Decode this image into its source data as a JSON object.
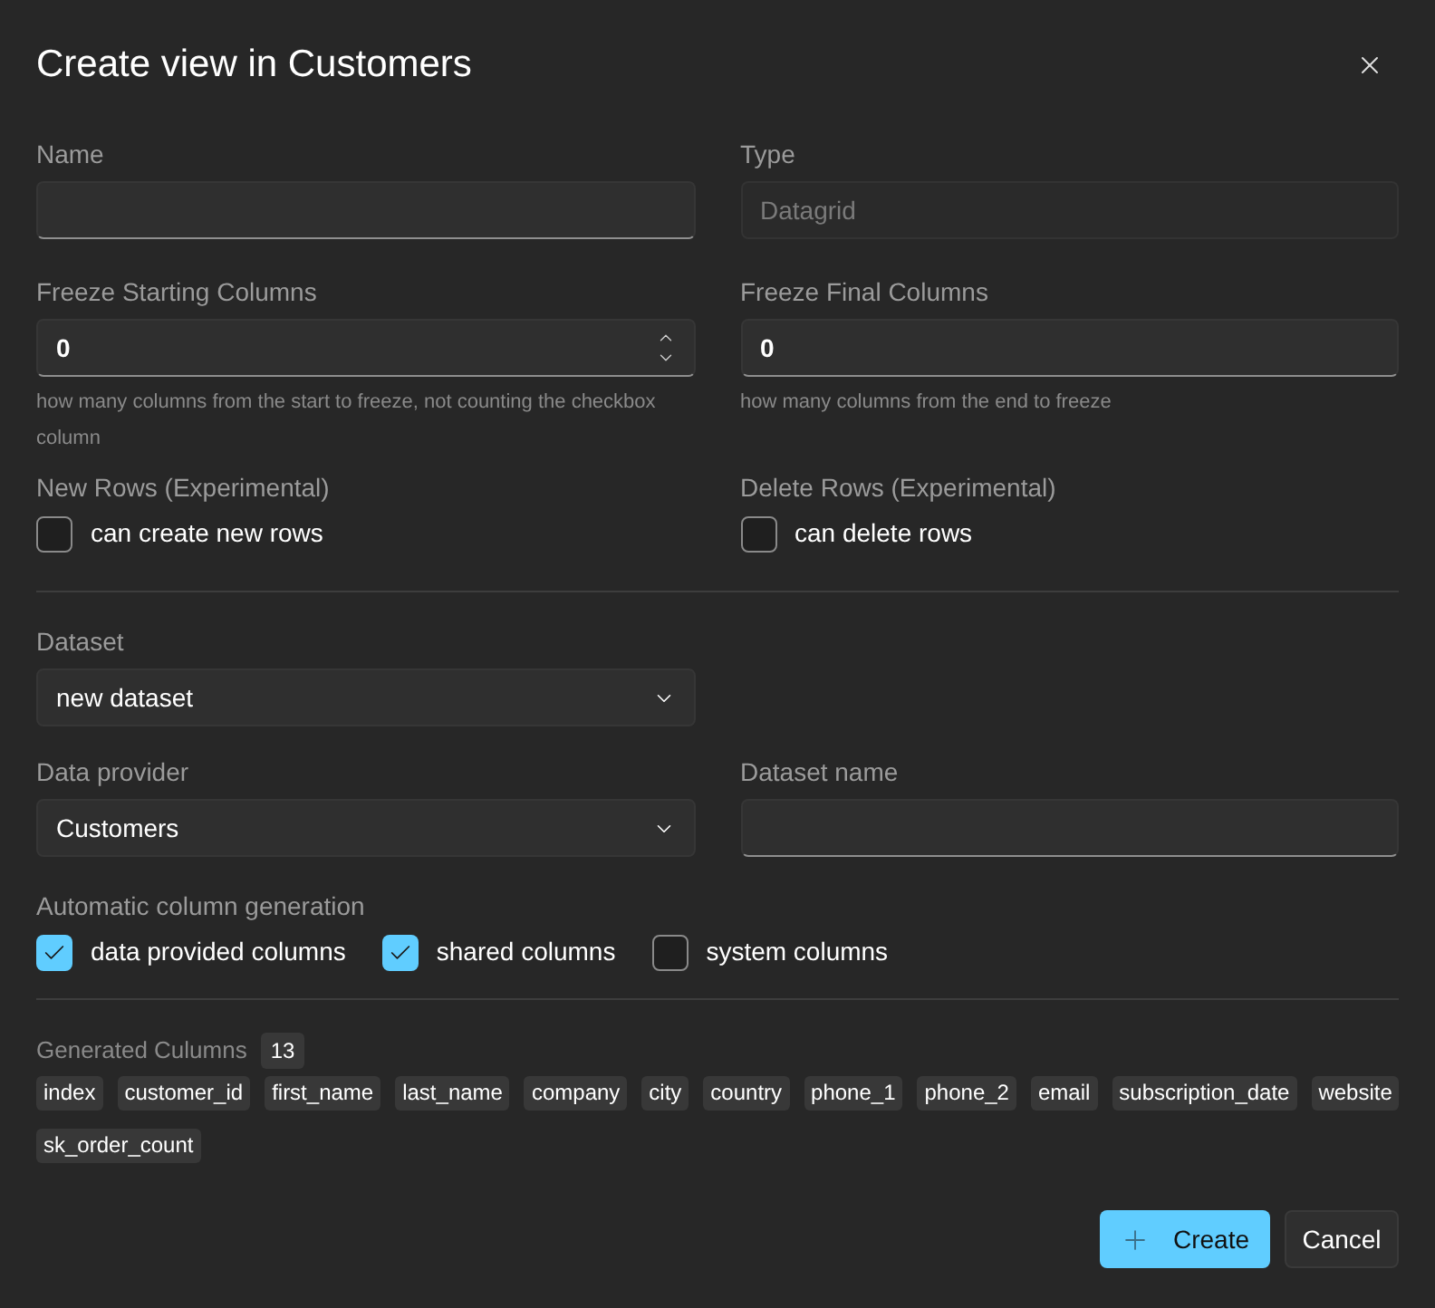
{
  "dialog": {
    "title": "Create view in Customers"
  },
  "name_field": {
    "label": "Name",
    "disabled": false
  },
  "type_field": {
    "label": "Type",
    "value": "Datagrid",
    "disabled": true
  },
  "freeze_start": {
    "label": "Freeze Starting Columns",
    "value": "0",
    "hint": "how many columns from the start to freeze, not counting the checkbox column",
    "spinner": true
  },
  "freeze_end": {
    "label": "Freeze Final Columns",
    "value": "0",
    "hint": "how many columns from the end to freeze",
    "spinner": false
  },
  "new_rows": {
    "label": "New Rows (Experimental)",
    "checkbox": {
      "label": "can create new rows",
      "checked": false
    }
  },
  "delete_rows": {
    "label": "Delete Rows (Experimental)",
    "checkbox": {
      "label": "can delete rows",
      "checked": false
    }
  },
  "dataset": {
    "label": "Dataset",
    "value": "new dataset"
  },
  "data_provider": {
    "label": "Data provider",
    "value": "Customers"
  },
  "dataset_name": {
    "label": "Dataset name"
  },
  "auto_columns": {
    "label": "Automatic column generation",
    "options": [
      {
        "label": "data provided columns",
        "checked": true
      },
      {
        "label": "shared columns",
        "checked": true
      },
      {
        "label": "system columns",
        "checked": false
      }
    ]
  },
  "generated_columns": {
    "label": "Generated Culumns",
    "count": "13",
    "columns": [
      "index",
      "customer_id",
      "first_name",
      "last_name",
      "company",
      "city",
      "country",
      "phone_1",
      "phone_2",
      "email",
      "subscription_date",
      "website",
      "sk_order_count"
    ]
  },
  "buttons": [
    {
      "label": "Create",
      "kind": "primary"
    },
    {
      "label": "Cancel",
      "kind": "secondary"
    }
  ]
}
